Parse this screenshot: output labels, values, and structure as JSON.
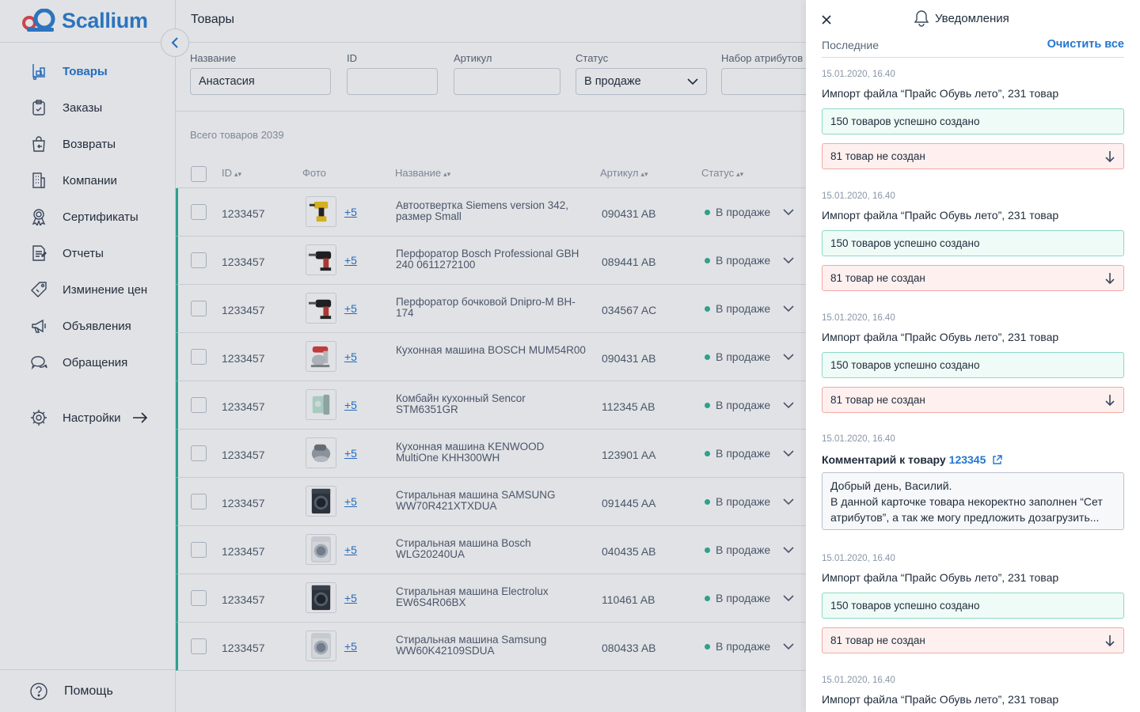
{
  "brand": {
    "name": "Scallium",
    "colors": {
      "accent": "#2476cf",
      "success": "#2fb39b",
      "error": "#f0aaa3"
    }
  },
  "sidebar": {
    "items": [
      {
        "label": "Товары",
        "icon": "cart-stand-icon",
        "active": true
      },
      {
        "label": "Заказы",
        "icon": "clipboard-check-icon",
        "active": false
      },
      {
        "label": "Возвраты",
        "icon": "return-bag-icon",
        "active": false
      },
      {
        "label": "Компании",
        "icon": "building-icon",
        "active": false
      },
      {
        "label": "Сертификаты",
        "icon": "certificate-icon",
        "active": false
      },
      {
        "label": "Отчеты",
        "icon": "report-icon",
        "active": false
      },
      {
        "label": "Изминение цен",
        "icon": "price-tag-icon",
        "active": false
      },
      {
        "label": "Объявления",
        "icon": "megaphone-icon",
        "active": false
      },
      {
        "label": "Обращения",
        "icon": "chat-icon",
        "active": false
      }
    ],
    "settings": "Настройки",
    "help": "Помощь"
  },
  "main": {
    "title": "Товары",
    "filters": {
      "name": {
        "label": "Название",
        "value": "Анастасия"
      },
      "id": {
        "label": "ID",
        "value": ""
      },
      "article": {
        "label": "Артикул",
        "value": ""
      },
      "status": {
        "label": "Статус",
        "value": "В продаже"
      },
      "attrs": {
        "label": "Набор атрибутов",
        "value": ""
      }
    },
    "total": "Всего товаров 2039",
    "columns": {
      "id": "ID",
      "photo": "Фото",
      "name": "Название",
      "article": "Артикул",
      "status": "Статус"
    },
    "rows": [
      {
        "id": "1233457",
        "more": "+5",
        "name": "Автоотвертка Siemens version 342, размер Small",
        "article": "090431 AB",
        "status": "В продаже",
        "img": "drill"
      },
      {
        "id": "1233457",
        "more": "+5",
        "name": "Перфоратор Bosch Professional GBH 240 0611272100",
        "article": "089441 AB",
        "status": "В продаже",
        "img": "perf"
      },
      {
        "id": "1233457",
        "more": "+5",
        "name": "Перфоратор бочковой Dnipro-M BH-174",
        "article": "034567 AC",
        "status": "В продаже",
        "img": "perf"
      },
      {
        "id": "1233457",
        "more": "+5",
        "name": "Кухонная машина BOSCH MUM54R00",
        "article": "090431 AB",
        "status": "В продаже",
        "img": "mixer"
      },
      {
        "id": "1233457",
        "more": "+5",
        "name": "Комбайн кухонный Sencor STM6351GR",
        "article": "112345 AB",
        "status": "В продаже",
        "img": "mixer2"
      },
      {
        "id": "1233457",
        "more": "+5",
        "name": "Кухонная машина KENWOOD MultiOne KHH300WH",
        "article": "123901 AA",
        "status": "В продаже",
        "img": "mixer3"
      },
      {
        "id": "1233457",
        "more": "+5",
        "name": "Стиральная машина SAMSUNG WW70R421XTXDUA",
        "article": "091445 AA",
        "status": "В продаже",
        "img": "washer-dark"
      },
      {
        "id": "1233457",
        "more": "+5",
        "name": "Стиральная машина Bosch WLG20240UA",
        "article": "040435 AB",
        "status": "В продаже",
        "img": "washer"
      },
      {
        "id": "1233457",
        "more": "+5",
        "name": "Стиральная машина Electrolux EW6S4R06BX",
        "article": "110461 AB",
        "status": "В продаже",
        "img": "washer-dark"
      },
      {
        "id": "1233457",
        "more": "+5",
        "name": "Стиральная машина Samsung WW60K42109SDUA",
        "article": "080433 AB",
        "status": "В продаже",
        "img": "washer"
      }
    ]
  },
  "notifications": {
    "title": "Уведомления",
    "recent": "Последние",
    "clear": "Очистить все",
    "items": [
      {
        "type": "import",
        "date": "15.01.2020, 16.40",
        "text": "Импорт файла “Прайс Обувь лето”, 231 товар",
        "ok": "150 товаров успешно создано",
        "err": "81 товар не создан"
      },
      {
        "type": "import",
        "date": "15.01.2020, 16.40",
        "text": "Импорт файла “Прайс Обувь лето”, 231 товар",
        "ok": "150 товаров успешно создано",
        "err": "81 товар не создан"
      },
      {
        "type": "import",
        "date": "15.01.2020, 16.40",
        "text": "Импорт файла “Прайс Обувь лето”, 231 товар",
        "ok": "150 товаров успешно создано",
        "err": "81 товар не создан"
      },
      {
        "type": "comment",
        "date": "15.01.2020, 16.40",
        "title": "Комментарий к товару",
        "link": "123345",
        "line1": "Добрый день, Василий.",
        "line2": "В данной карточке товара некоректно заполнен “Сет атрибутов”, а так же могу предложить дозагрузить..."
      },
      {
        "type": "import",
        "date": "15.01.2020, 16.40",
        "text": "Импорт файла “Прайс Обувь лето”, 231 товар",
        "ok": "150 товаров успешно создано",
        "err": "81 товар не создан"
      },
      {
        "type": "import",
        "date": "15.01.2020, 16.40",
        "text": "Импорт файла “Прайс Обувь лето”, 231 товар"
      }
    ]
  }
}
